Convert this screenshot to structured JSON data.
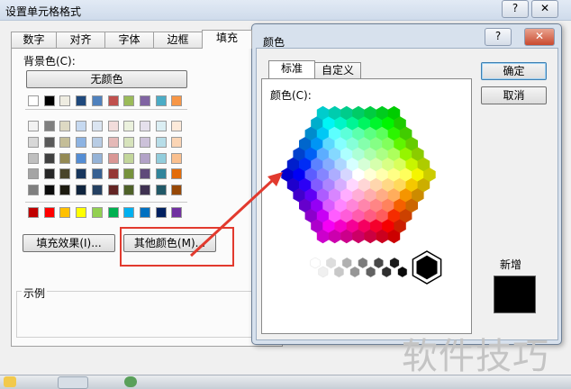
{
  "format_cells": {
    "title": "设置单元格格式",
    "help_button": "?",
    "close_button": "✕",
    "tabs": [
      "数字",
      "对齐",
      "字体",
      "边框",
      "填充"
    ],
    "background_color_label": "背景色(C):",
    "no_color_button": "无颜色",
    "fill_effects_button": "填充效果(I)...",
    "more_colors_button": "其他颜色(M)...",
    "example_label": "示例",
    "palette_row_top": [
      "#ffffff",
      "#000000",
      "#eeece1",
      "#1f497d",
      "#4f81bd",
      "#c0504d",
      "#9bbb59",
      "#8064a2",
      "#4bacc6",
      "#f79646"
    ],
    "palette_rows_tint": [
      [
        "#f2f2f2",
        "#7f7f7f",
        "#ddd9c3",
        "#c6d9f0",
        "#dbe5f1",
        "#f2dcdb",
        "#ebf1dd",
        "#e5e0ec",
        "#dbeef3",
        "#fdeada"
      ],
      [
        "#d8d8d8",
        "#595959",
        "#c4bd97",
        "#8db3e2",
        "#b8cce4",
        "#e5b9b7",
        "#d7e3bc",
        "#ccc1d9",
        "#b7dde8",
        "#fbd5b5"
      ],
      [
        "#bfbfbf",
        "#3f3f3f",
        "#938953",
        "#548dd4",
        "#95b3d7",
        "#d99694",
        "#c3d69b",
        "#b2a2c7",
        "#92cddc",
        "#fac08f"
      ],
      [
        "#a5a5a5",
        "#262626",
        "#494429",
        "#17365d",
        "#366092",
        "#953734",
        "#76923c",
        "#5f497a",
        "#31859b",
        "#e36c09"
      ],
      [
        "#7f7f7f",
        "#0c0c0c",
        "#1d1b10",
        "#0f243e",
        "#244061",
        "#632423",
        "#4f6128",
        "#3f3151",
        "#205867",
        "#974806"
      ]
    ],
    "palette_row_standard": [
      "#c00000",
      "#ff0000",
      "#ffc000",
      "#ffff00",
      "#92d050",
      "#00b050",
      "#00b0f0",
      "#0070c0",
      "#002060",
      "#7030a0"
    ]
  },
  "color_dialog": {
    "title": "颜色",
    "help_button": "?",
    "close_button": "✕",
    "tabs": [
      "标准",
      "自定义"
    ],
    "colors_label": "颜色(C):",
    "ok_button": "确定",
    "cancel_button": "取消",
    "new_label": "新增",
    "new_color": "#000000"
  },
  "watermark": "软件技巧",
  "accent_colors": {
    "annotation_red": "#e23a2e"
  }
}
